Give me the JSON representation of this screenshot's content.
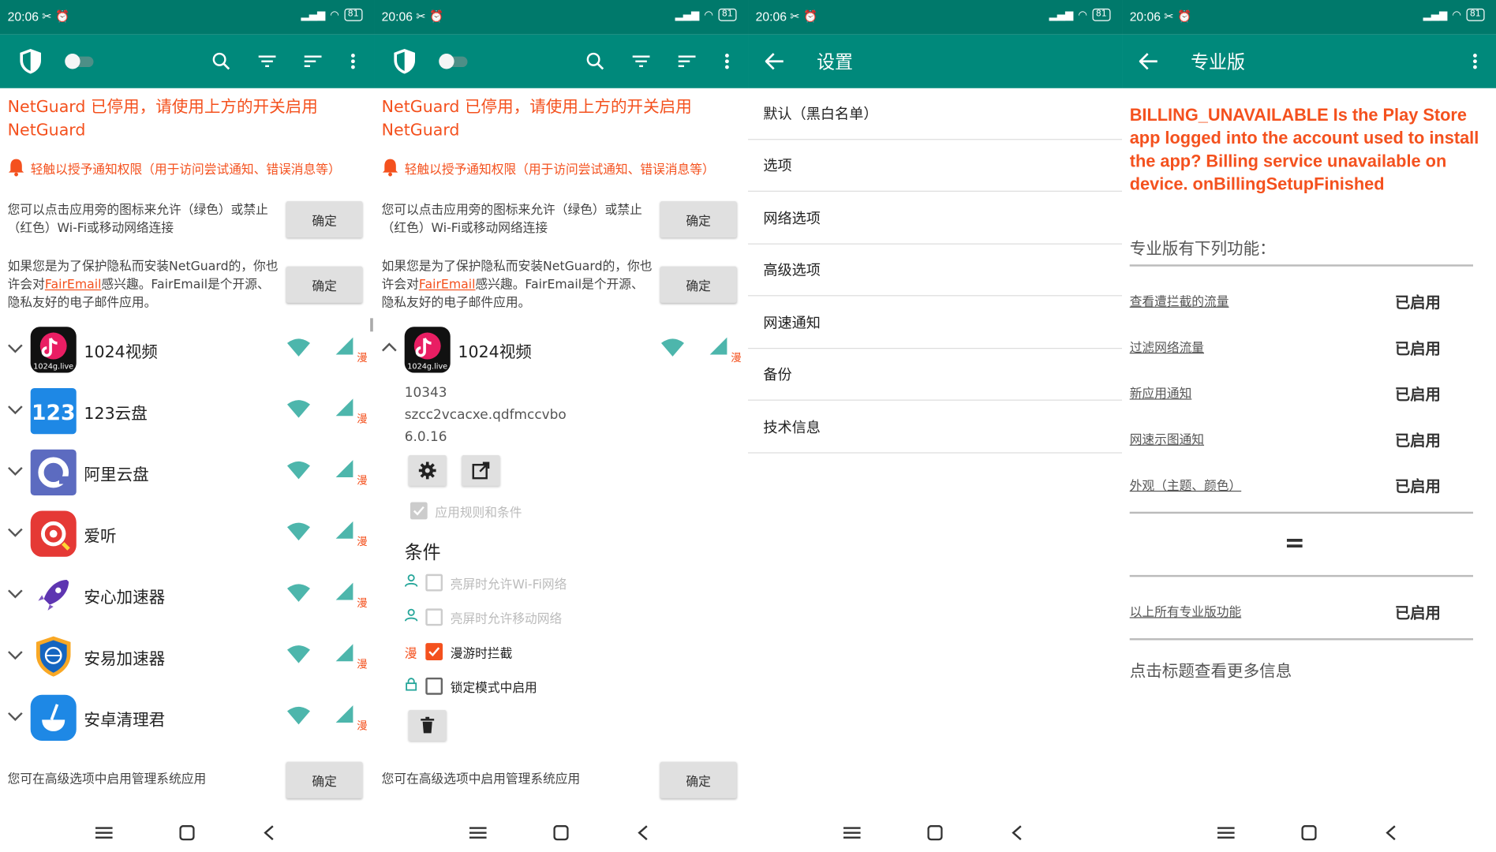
{
  "status": {
    "time": "20:06",
    "signal": "HD ..l ..l",
    "battery": "81"
  },
  "colors": {
    "primary": "#00897b",
    "status_bar": "#00796b",
    "warning": "#f4511e",
    "allow": "#4db6ac"
  },
  "screen1": {
    "warning": "NetGuard 已停用，请使用上方的开关启用 NetGuard",
    "notify": "轻触以授予通知权限（用于访问尝试通知、错误消息等）",
    "hint1": "您可以点击应用旁的图标来允许（绿色）或禁止（红色）Wi-Fi或移动网络连接",
    "hint2_pre": "如果您是为了保护隐私而安装NetGuard的，你也许会对",
    "hint2_link": "FairEmail",
    "hint2_post": "感兴趣。FairEmail是个开源、隐私友好的电子邮件应用。",
    "ok": "确定",
    "roam_mark": "漫",
    "apps": [
      {
        "name": "1024视频",
        "icon": "tiktok-style-icon",
        "label": "1024g.live"
      },
      {
        "name": "123云盘",
        "icon": "cloud-123-icon",
        "label": "123"
      },
      {
        "name": "阿里云盘",
        "icon": "aliyun-drive-icon"
      },
      {
        "name": "爱听",
        "icon": "aiting-icon"
      },
      {
        "name": "安心加速器",
        "icon": "rocket-icon"
      },
      {
        "name": "安易加速器",
        "icon": "shield-globe-icon"
      },
      {
        "name": "安卓清理君",
        "icon": "broom-icon"
      }
    ],
    "bottom_hint": "您可在高级选项中启用管理系统应用"
  },
  "screen2": {
    "app_name": "1024视频",
    "app_label": "1024g.live",
    "uid": "10343",
    "package": "szcc2vcacxe.qdfmccvbo",
    "version": "6.0.16",
    "apply_rules": "应用规则和条件",
    "conditions_title": "条件",
    "cond_screen_wifi": "亮屏时允许Wi-Fi网络",
    "cond_screen_mobile": "亮屏时允许移动网络",
    "cond_roaming": "漫游时拦截",
    "cond_lockdown": "锁定模式中启用"
  },
  "screen3": {
    "title": "设置",
    "items": [
      "默认（黑白名单）",
      "选项",
      "网络选项",
      "高级选项",
      "网速通知",
      "备份",
      "技术信息"
    ]
  },
  "screen4": {
    "title": "专业版",
    "error": "BILLING_UNAVAILABLE Is the Play Store app logged into the account used to install the app? Billing service unavailable on device. onBillingSetupFinished",
    "heading": "专业版有下列功能：",
    "features": [
      {
        "label": "查看遭拦截的流量",
        "status": "已启用"
      },
      {
        "label": "过滤网络流量",
        "status": "已启用"
      },
      {
        "label": "新应用通知",
        "status": "已启用"
      },
      {
        "label": "网速示图通知",
        "status": "已启用"
      },
      {
        "label": "外观（主题、颜色）",
        "status": "已启用"
      }
    ],
    "equals": "=",
    "all_label": "以上所有专业版功能",
    "all_status": "已启用",
    "footer": "点击标题查看更多信息"
  }
}
